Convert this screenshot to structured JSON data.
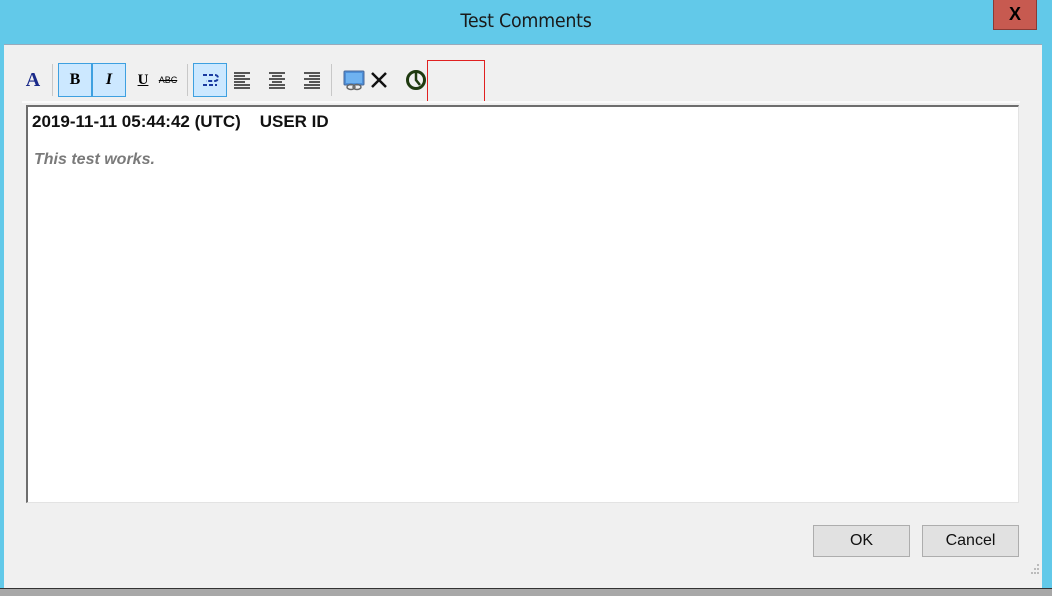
{
  "window": {
    "title": "Test Comments",
    "close_label": "X"
  },
  "toolbar": {
    "buttons": [
      {
        "name": "font-color",
        "glyph": "A"
      },
      {
        "name": "bold",
        "glyph": "B",
        "active": true
      },
      {
        "name": "italic",
        "glyph": "I",
        "active": true
      },
      {
        "name": "underline",
        "glyph": "U"
      },
      {
        "name": "strikethrough",
        "glyph": "ABC"
      },
      {
        "name": "wrap",
        "active": true
      },
      {
        "name": "align-left"
      },
      {
        "name": "align-center"
      },
      {
        "name": "align-right"
      },
      {
        "name": "insert-link"
      },
      {
        "name": "delete"
      },
      {
        "name": "timestamp",
        "highlighted": true
      }
    ]
  },
  "editor": {
    "header": "2019-11-11 05:44:42 (UTC)    USER ID",
    "comment": "This test works."
  },
  "buttons": {
    "ok": "OK",
    "cancel": "Cancel"
  }
}
